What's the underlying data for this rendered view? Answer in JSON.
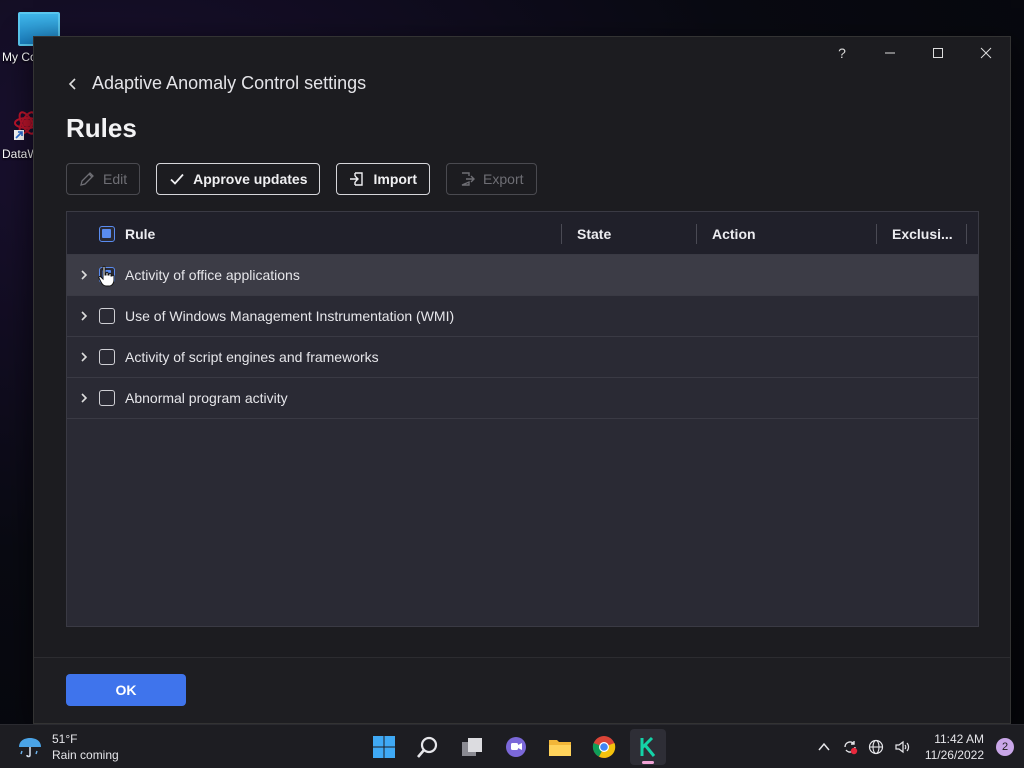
{
  "desktop": {
    "icons": [
      {
        "label": "My Co",
        "icon": "computer-icon"
      },
      {
        "label": "DataW",
        "icon": "datawrapper-icon"
      }
    ]
  },
  "window": {
    "help_label": "?",
    "back_title": "Adaptive Anomaly Control settings",
    "page_title": "Rules",
    "toolbar": {
      "edit": "Edit",
      "approve": "Approve updates",
      "import": "Import",
      "export": "Export"
    },
    "table": {
      "columns": {
        "rule": "Rule",
        "state": "State",
        "action": "Action",
        "exclusions": "Exclusi..."
      },
      "rows": [
        {
          "label": "Activity of office applications"
        },
        {
          "label": "Use of Windows Management Instrumentation (WMI)"
        },
        {
          "label": "Activity of script engines and frameworks"
        },
        {
          "label": "Abnormal program activity"
        }
      ]
    },
    "ok_label": "OK"
  },
  "taskbar": {
    "weather": {
      "temp": "51°F",
      "desc": "Rain coming"
    },
    "apps": [
      "windows-start-icon",
      "search-icon",
      "task-view-icon",
      "teams-chat-icon",
      "file-explorer-icon",
      "chrome-icon",
      "kaspersky-icon"
    ],
    "clock": {
      "time": "11:42 AM",
      "date": "11/26/2022"
    },
    "notifications": "2"
  },
  "colors": {
    "accent": "#3f74ec",
    "window_bg": "#1c1c20",
    "table_bg": "#2a2a34"
  }
}
